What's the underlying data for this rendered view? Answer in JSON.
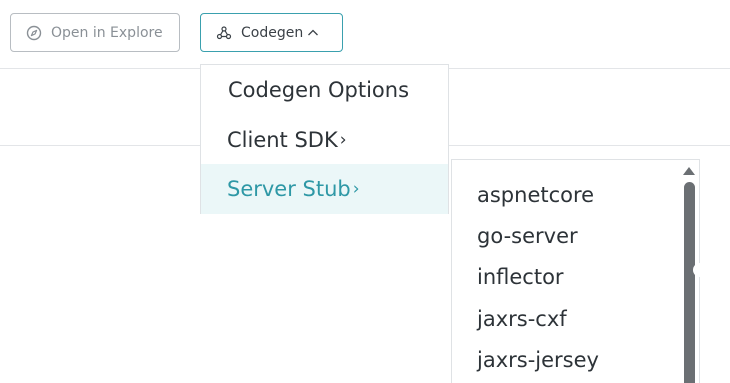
{
  "toolbar": {
    "explore_label": "Open in Explore",
    "codegen_label": "Codegen"
  },
  "codegen_menu": {
    "title": "Codegen Options",
    "items": [
      {
        "label": "Client SDK",
        "arrow": "›"
      },
      {
        "label": "Server Stub",
        "arrow": "›"
      }
    ]
  },
  "server_stub_menu": {
    "items": [
      "aspnetcore",
      "go-server",
      "inflector",
      "jaxrs-cxf",
      "jaxrs-jersey"
    ]
  },
  "colors": {
    "accent": "#2e98a6",
    "highlight_bg": "#ebf7f8",
    "border": "#dfe2e5",
    "text": "#2d3338"
  }
}
